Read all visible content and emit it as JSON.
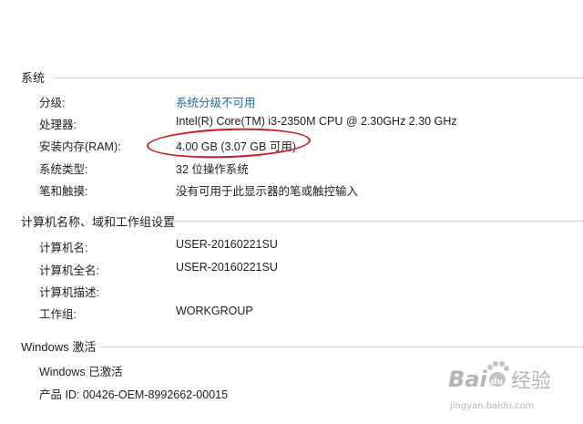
{
  "system": {
    "title": "系统",
    "rows": [
      {
        "label": "分级:",
        "value": "系统分级不可用"
      },
      {
        "label": "处理器:",
        "value": "Intel(R) Core(TM) i3-2350M CPU @ 2.30GHz   2.30 GHz"
      },
      {
        "label": "安装内存(RAM):",
        "value": "4.00 GB (3.07 GB 可用)"
      },
      {
        "label": "系统类型:",
        "value": "32 位操作系统"
      },
      {
        "label": "笔和触摸:",
        "value": "没有可用于此显示器的笔或触控输入"
      }
    ]
  },
  "computer": {
    "title": "计算机名称、域和工作组设置",
    "rows": [
      {
        "label": "计算机名:",
        "value": "USER-20160221SU"
      },
      {
        "label": "计算机全名:",
        "value": "USER-20160221SU"
      },
      {
        "label": "计算机描述:",
        "value": ""
      },
      {
        "label": "工作组:",
        "value": "WORKGROUP"
      }
    ]
  },
  "activation": {
    "title": "Windows 激活",
    "status": "Windows 已激活",
    "product_id": "产品 ID: 00426-OEM-8992662-00015"
  },
  "watermark": {
    "brand": "Bai",
    "paw": "du",
    "suffix": "经验",
    "url": "jingyan.baidu.com"
  },
  "colors": {
    "link": "#1a6aa8",
    "annotation": "#c81e1e",
    "rule": "#d9d9d9"
  }
}
